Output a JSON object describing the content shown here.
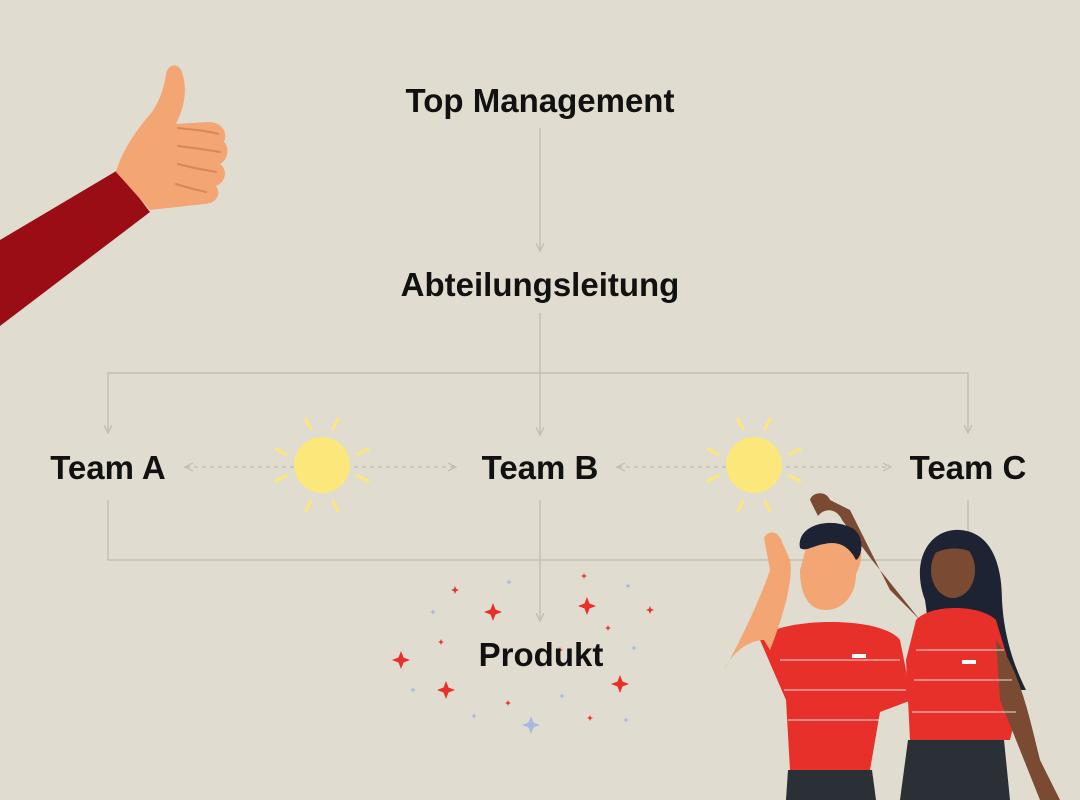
{
  "diagram": {
    "nodes": {
      "top_management": "Top Management",
      "abteilungsleitung": "Abteilungsleitung",
      "team_a": "Team A",
      "team_b": "Team B",
      "team_c": "Team C",
      "produkt": "Produkt"
    }
  },
  "colors": {
    "background": "#e0ddd0",
    "connector": "#c2bfb2",
    "sun": "#fce77a",
    "sleeve": "#9a0d15",
    "skin_light": "#f3a574",
    "skin_dark": "#7a4a32",
    "shirt": "#e8302b",
    "hair": "#1d2333",
    "pants": "#2b2f36",
    "sparkle_red": "#e8302b",
    "sparkle_blue": "#a9b9de"
  },
  "icons": [
    "thumbs-up-icon",
    "sun-icon",
    "sun-icon",
    "sparkle-icon",
    "people-high-five-icon"
  ]
}
